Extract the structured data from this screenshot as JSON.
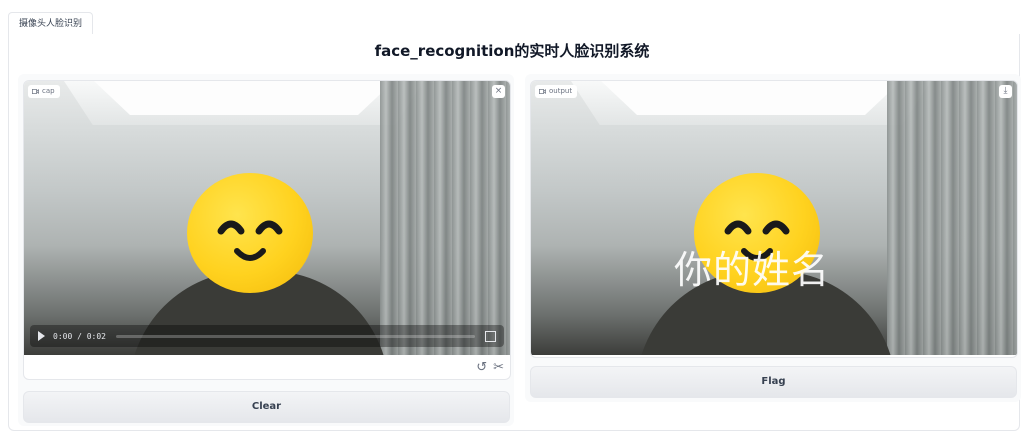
{
  "tab": {
    "label": "摄像头人脸识别"
  },
  "title": "face_recognition的实时人脸识别系统",
  "input": {
    "label": "cap",
    "close_icon": "×",
    "time": "0:00 / 0:02"
  },
  "output": {
    "label": "output",
    "download_icon": "⤓",
    "overlay_text": "你的姓名"
  },
  "buttons": {
    "clear": "Clear",
    "flag": "Flag"
  },
  "colors": {
    "emoji": "#ffd21f",
    "button_bg": "#e5e7eb"
  }
}
